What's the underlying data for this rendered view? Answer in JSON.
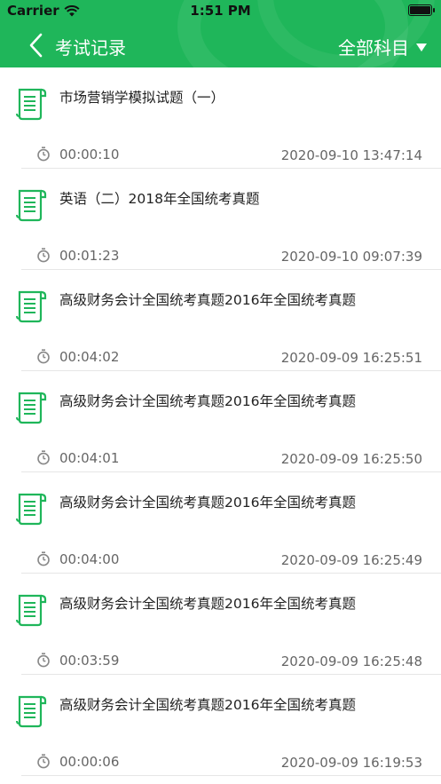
{
  "status_bar": {
    "carrier": "Carrier",
    "time": "1:51 PM"
  },
  "nav": {
    "title": "考试记录",
    "filter_label": "全部科目"
  },
  "colors": {
    "brand": "#1fb65a",
    "icon": "#1fb65a"
  },
  "records": [
    {
      "title": "市场营销学模拟试题（一）",
      "duration": "00:00:10",
      "date": "2020-09-10 13:47:14"
    },
    {
      "title": "英语（二）2018年全国统考真题",
      "duration": "00:01:23",
      "date": "2020-09-10 09:07:39"
    },
    {
      "title": "高级财务会计全国统考真题2016年全国统考真题",
      "duration": "00:04:02",
      "date": "2020-09-09 16:25:51"
    },
    {
      "title": "高级财务会计全国统考真题2016年全国统考真题",
      "duration": "00:04:01",
      "date": "2020-09-09 16:25:50"
    },
    {
      "title": "高级财务会计全国统考真题2016年全国统考真题",
      "duration": "00:04:00",
      "date": "2020-09-09 16:25:49"
    },
    {
      "title": "高级财务会计全国统考真题2016年全国统考真题",
      "duration": "00:03:59",
      "date": "2020-09-09 16:25:48"
    },
    {
      "title": "高级财务会计全国统考真题2016年全国统考真题",
      "duration": "00:00:06",
      "date": "2020-09-09 16:19:53"
    }
  ]
}
